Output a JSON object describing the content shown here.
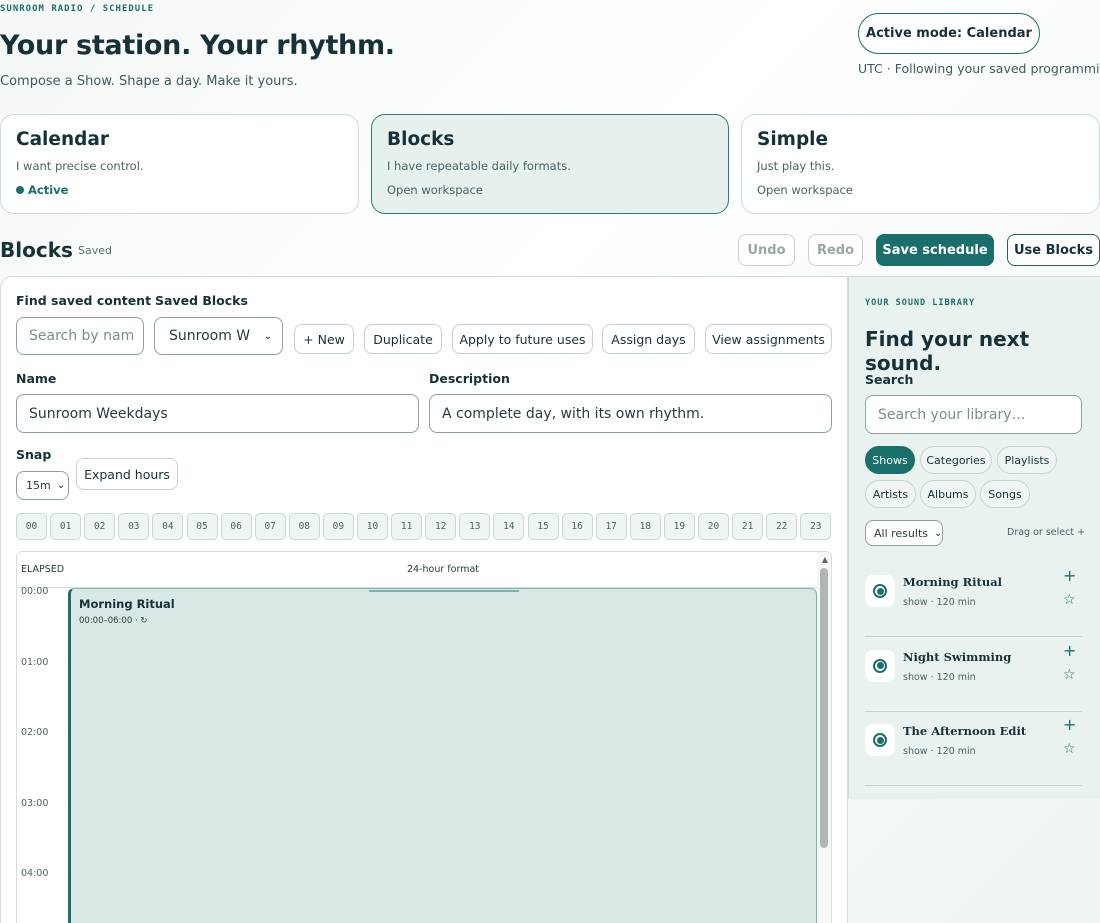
{
  "header": {
    "breadcrumb": "SUNROOM RADIO / SCHEDULE",
    "title": "Your station. Your rhythm.",
    "subtitle": "Compose a Show. Shape a day. Make it yours.",
    "active_mode": "Active mode: Calendar",
    "status_line": "UTC · Following your saved programming"
  },
  "modes": [
    {
      "title": "Calendar",
      "desc": "I want precise control.",
      "status": "Active"
    },
    {
      "title": "Blocks",
      "desc": "I have repeatable daily formats.",
      "status": "Open workspace"
    },
    {
      "title": "Simple",
      "desc": "Just play this.",
      "status": "Open workspace"
    }
  ],
  "blocks_bar": {
    "title": "Blocks",
    "saved": "Saved",
    "undo": "Undo",
    "redo": "Redo",
    "save": "Save schedule",
    "use": "Use Blocks"
  },
  "editor": {
    "find_label": "Find saved content",
    "find_placeholder": "Search by nam",
    "saved_blocks_label": "Saved Blocks",
    "saved_blocks_value": "Sunroom W",
    "new": "+ New",
    "duplicate": "Duplicate",
    "apply": "Apply to future uses",
    "assign": "Assign days",
    "view": "View assignments",
    "name_label": "Name",
    "name_value": "Sunroom Weekdays",
    "desc_label": "Description",
    "desc_value": "A complete day, with its own rhythm.",
    "snap_label": "Snap",
    "snap_value": "15m",
    "expand": "Expand hours"
  },
  "hours": [
    "00",
    "01",
    "02",
    "03",
    "04",
    "05",
    "06",
    "07",
    "08",
    "09",
    "10",
    "11",
    "12",
    "13",
    "14",
    "15",
    "16",
    "17",
    "18",
    "19",
    "20",
    "21",
    "22",
    "23"
  ],
  "timeline": {
    "elapsed": "ELAPSED",
    "format": "24-hour format",
    "hour_labels": [
      "00:00",
      "01:00",
      "02:00",
      "03:00",
      "04:00"
    ],
    "event_title": "Morning Ritual",
    "event_meta": "00:00–06:00 · ↻"
  },
  "library": {
    "kicker": "YOUR SOUND LIBRARY",
    "title": "Find your next sound.",
    "search_label": "Search",
    "search_placeholder": "Search your library…",
    "filters": [
      "Shows",
      "Categories",
      "Playlists",
      "Artists",
      "Albums",
      "Songs"
    ],
    "results_select": "All results",
    "hint": "Drag or select +",
    "items": [
      {
        "title": "Morning Ritual",
        "meta": "show · 120 min"
      },
      {
        "title": "Night Swimming",
        "meta": "show · 120 min"
      },
      {
        "title": "The Afternoon Edit",
        "meta": "show · 120 min"
      }
    ]
  }
}
